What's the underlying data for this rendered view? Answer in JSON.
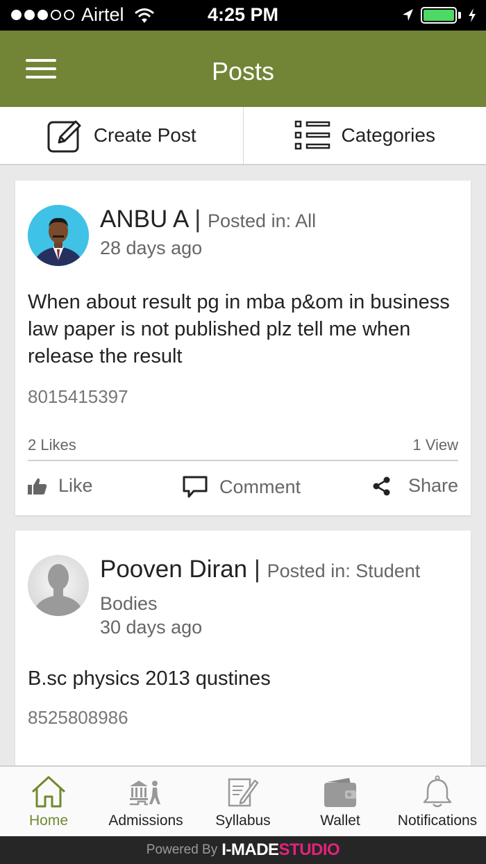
{
  "status_bar": {
    "carrier": "Airtel",
    "time": "4:25 PM"
  },
  "header": {
    "title": "Posts"
  },
  "actions": {
    "create_post": "Create Post",
    "categories": "Categories"
  },
  "posts": [
    {
      "author": "ANBU A",
      "posted_in_label": "Posted in: All",
      "time_ago": "28 days ago",
      "text": "When about result pg in mba p&om in business law paper is not published plz tell me when release the result",
      "phone": "8015415397",
      "likes": "2 Likes",
      "views": "1 View"
    },
    {
      "author": "Pooven Diran",
      "posted_in_label": "Posted in: Student Bodies",
      "time_ago": "30 days ago",
      "text": "B.sc physics 2013 qustines",
      "phone": "8525808986"
    }
  ],
  "post_actions": {
    "like": "Like",
    "comment": "Comment",
    "share": "Share"
  },
  "tabs": [
    {
      "label": "Home",
      "icon": "home-icon",
      "active": true
    },
    {
      "label": "Admissions",
      "icon": "admissions-icon"
    },
    {
      "label": "Syllabus",
      "icon": "syllabus-icon"
    },
    {
      "label": "Wallet",
      "icon": "wallet-icon"
    },
    {
      "label": "Notifications",
      "icon": "bell-icon"
    }
  ],
  "footer": {
    "powered_by": "Powered By",
    "brand_main": "I-MADE",
    "brand_accent": "STUDIO"
  },
  "colors": {
    "header": "#728537",
    "accent_tab": "#6f8a2f",
    "battery": "#4cd964",
    "brand_pink": "#e0237a"
  }
}
